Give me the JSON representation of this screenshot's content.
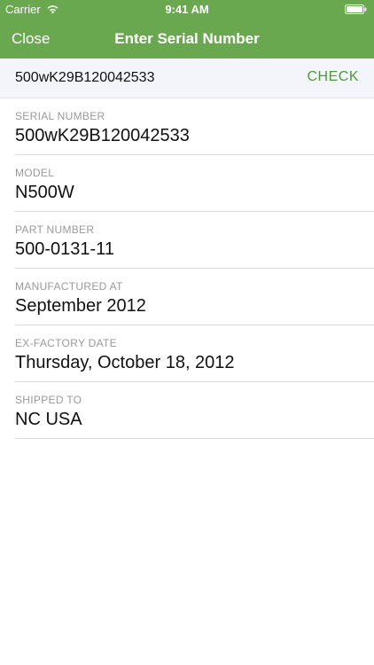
{
  "status_bar": {
    "carrier": "Carrier",
    "time": "9:41 AM"
  },
  "nav": {
    "close_label": "Close",
    "title": "Enter Serial Number"
  },
  "search": {
    "value": "500wK29B120042533",
    "check_label": "CHECK"
  },
  "details": [
    {
      "label": "SERIAL NUMBER",
      "value": "500wK29B120042533"
    },
    {
      "label": "MODEL",
      "value": "N500W"
    },
    {
      "label": "PART NUMBER",
      "value": "500-0131-11"
    },
    {
      "label": "MANUFACTURED AT",
      "value": "September 2012"
    },
    {
      "label": "EX-FACTORY DATE",
      "value": "Thursday, October 18, 2012"
    },
    {
      "label": "SHIPPED TO",
      "value": "NC USA"
    }
  ],
  "colors": {
    "nav_background": "#6aa84f",
    "accent": "#4e9a3a",
    "search_background": "#f4f4fb"
  },
  "icons": {
    "wifi": "wifi-icon",
    "battery": "battery-icon"
  }
}
